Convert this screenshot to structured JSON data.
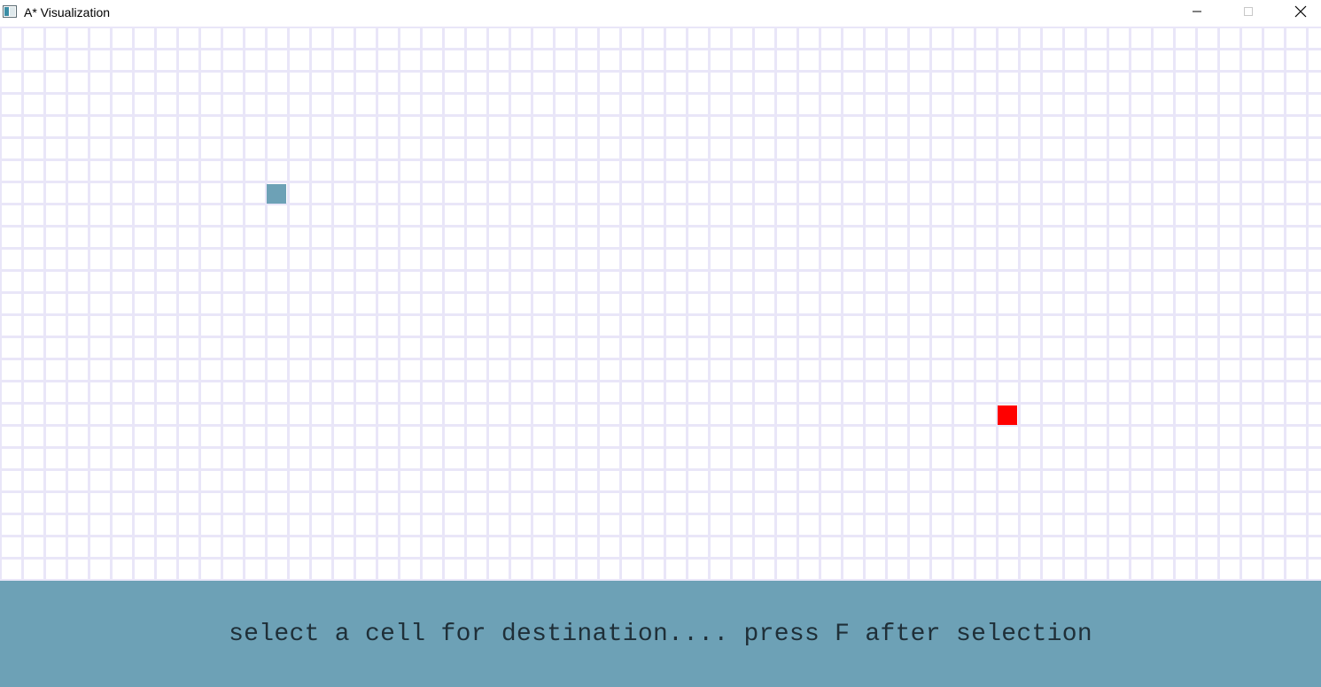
{
  "window": {
    "title": "A* Visualization",
    "controls": {
      "minimize_icon": "minimize-icon",
      "maximize_icon": "maximize-icon",
      "close_icon": "close-icon"
    }
  },
  "grid": {
    "line_color": "#e9e6f8",
    "background_color": "#ffffff",
    "cells": {
      "source": {
        "color": "#6da1b6"
      },
      "destination": {
        "color": "#ff0000"
      }
    }
  },
  "status": {
    "message": "select a cell for destination.... press F after selection",
    "background_color": "#6da1b6",
    "text_color": "#1f2f38"
  }
}
